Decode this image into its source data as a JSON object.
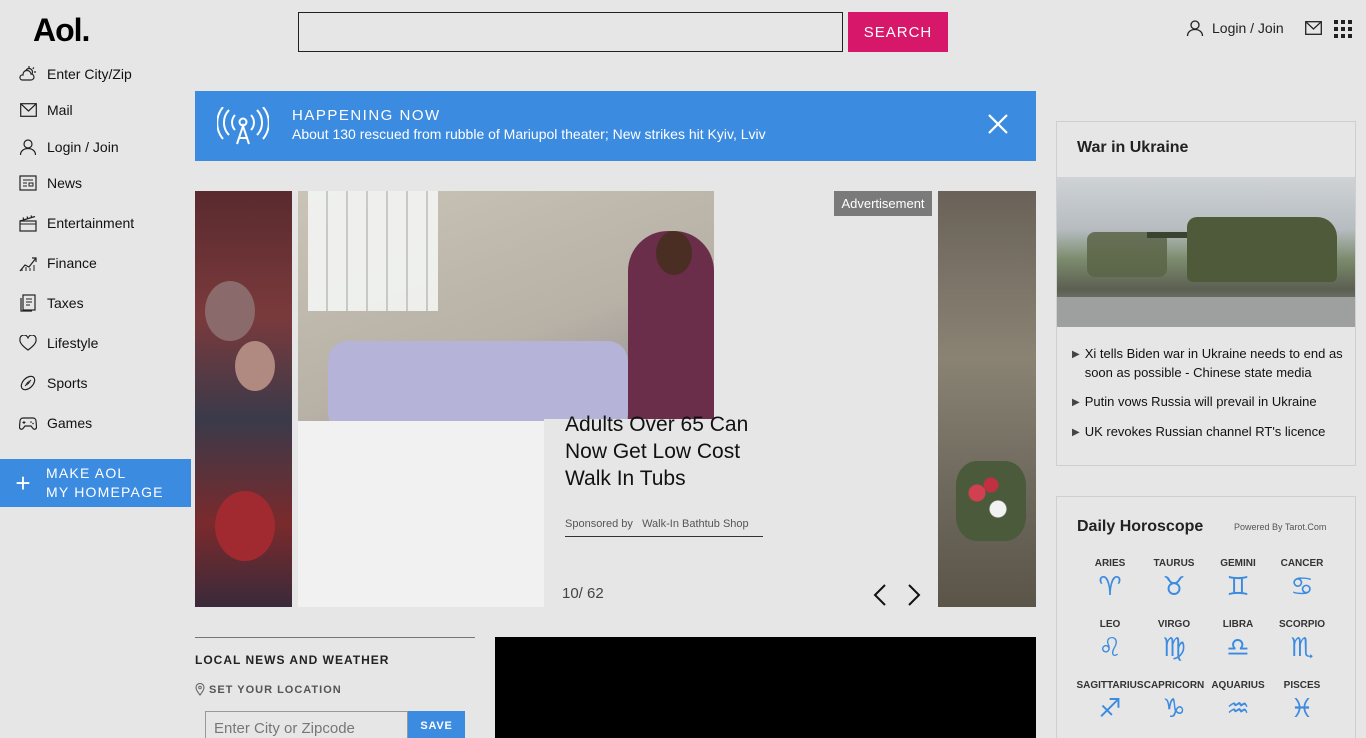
{
  "header": {
    "logo": "Aol.",
    "search_value": "",
    "search_label": "SEARCH",
    "login_label": "Login / Join"
  },
  "sidebar": {
    "items": [
      {
        "label": "Enter City/Zip",
        "icon": "weather-icon"
      },
      {
        "label": "Mail",
        "icon": "mail-icon"
      },
      {
        "label": "Login / Join",
        "icon": "user-icon"
      },
      {
        "label": "News",
        "icon": "news-icon"
      },
      {
        "label": "Entertainment",
        "icon": "clapperboard-icon"
      },
      {
        "label": "Finance",
        "icon": "chart-icon"
      },
      {
        "label": "Taxes",
        "icon": "document-icon"
      },
      {
        "label": "Lifestyle",
        "icon": "heart-icon"
      },
      {
        "label": "Sports",
        "icon": "football-icon"
      },
      {
        "label": "Games",
        "icon": "gamepad-icon"
      }
    ],
    "make_home_line1": "MAKE AOL",
    "make_home_line2": "MY HOMEPAGE"
  },
  "happening": {
    "title": "HAPPENING NOW",
    "text": "About 130 rescued from rubble of Mariupol theater; New strikes hit Kyiv, Lviv"
  },
  "carousel": {
    "headline": "Adults Over 65 Can Now Get Low Cost Walk In Tubs",
    "sponsored_by": "Sponsored by",
    "sponsor": "Walk-In Bathtub Shop",
    "counter": "10/ 62",
    "ad_label": "Advertisement"
  },
  "local": {
    "title": "LOCAL NEWS AND WEATHER",
    "set_location": "SET YOUR LOCATION",
    "city_placeholder": "Enter City or Zipcode",
    "save_label": "SAVE"
  },
  "war": {
    "title": "War in Ukraine",
    "items": [
      "Xi tells Biden war in Ukraine needs to end as soon as possible - Chinese state media",
      "Putin vows Russia will prevail in Ukraine",
      "UK revokes Russian channel RT's licence"
    ]
  },
  "horoscope": {
    "title": "Daily Horoscope",
    "powered_by": "Powered By Tarot.Com",
    "signs": [
      {
        "name": "ARIES",
        "glyph": "♈"
      },
      {
        "name": "TAURUS",
        "glyph": "♉"
      },
      {
        "name": "GEMINI",
        "glyph": "♊"
      },
      {
        "name": "CANCER",
        "glyph": "♋"
      },
      {
        "name": "LEO",
        "glyph": "♌"
      },
      {
        "name": "VIRGO",
        "glyph": "♍"
      },
      {
        "name": "LIBRA",
        "glyph": "♎"
      },
      {
        "name": "SCORPIO",
        "glyph": "♏"
      },
      {
        "name": "SAGITTARIUS",
        "glyph": "♐"
      },
      {
        "name": "CAPRICORN",
        "glyph": "♑"
      },
      {
        "name": "AQUARIUS",
        "glyph": "♒"
      },
      {
        "name": "PISCES",
        "glyph": "♓"
      }
    ]
  },
  "colors": {
    "accent_blue": "#3b8be0",
    "search_pink": "#d6176a"
  }
}
